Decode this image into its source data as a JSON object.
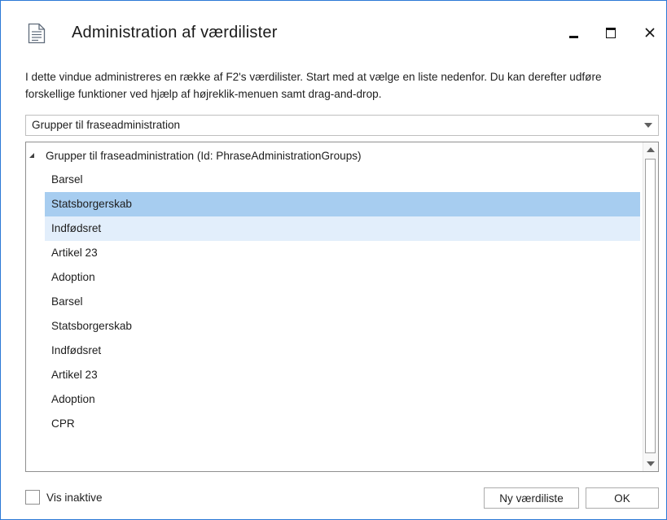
{
  "window": {
    "title": "Administration af værdilister",
    "accent_color": "#2b79d6",
    "icon": "document-icon",
    "controls": {
      "minimize": "minimize-icon",
      "maximize": "maximize-icon",
      "close_glyph": "✕"
    }
  },
  "description": "I dette vindue administreres en række af F2's værdilister. Start med at vælge en liste nedenfor. Du kan derefter udføre forskellige funktioner ved hjælp af højreklik-menuen samt drag-and-drop.",
  "list_selector": {
    "selected": "Grupper til fraseadministration",
    "icon": "chevron-down-icon"
  },
  "tree": {
    "root_label": "Grupper til fraseadministration (Id: PhraseAdministrationGroups)",
    "expanded": true,
    "selected_color": "#a7cdf0",
    "hover_color": "#e2eefb",
    "items": [
      {
        "label": "Barsel",
        "state": "normal"
      },
      {
        "label": "Statsborgerskab",
        "state": "selected"
      },
      {
        "label": "Indfødsret",
        "state": "hover"
      },
      {
        "label": "Artikel 23",
        "state": "normal"
      },
      {
        "label": "Adoption",
        "state": "normal"
      },
      {
        "label": "Barsel",
        "state": "normal"
      },
      {
        "label": "Statsborgerskab",
        "state": "normal"
      },
      {
        "label": "Indfødsret",
        "state": "normal"
      },
      {
        "label": "Artikel 23",
        "state": "normal"
      },
      {
        "label": "Adoption",
        "state": "normal"
      },
      {
        "label": "CPR",
        "state": "normal"
      }
    ]
  },
  "footer": {
    "show_inactive_label": "Vis inaktive",
    "show_inactive_checked": false,
    "new_list_button": "Ny værdiliste",
    "ok_button": "OK"
  }
}
